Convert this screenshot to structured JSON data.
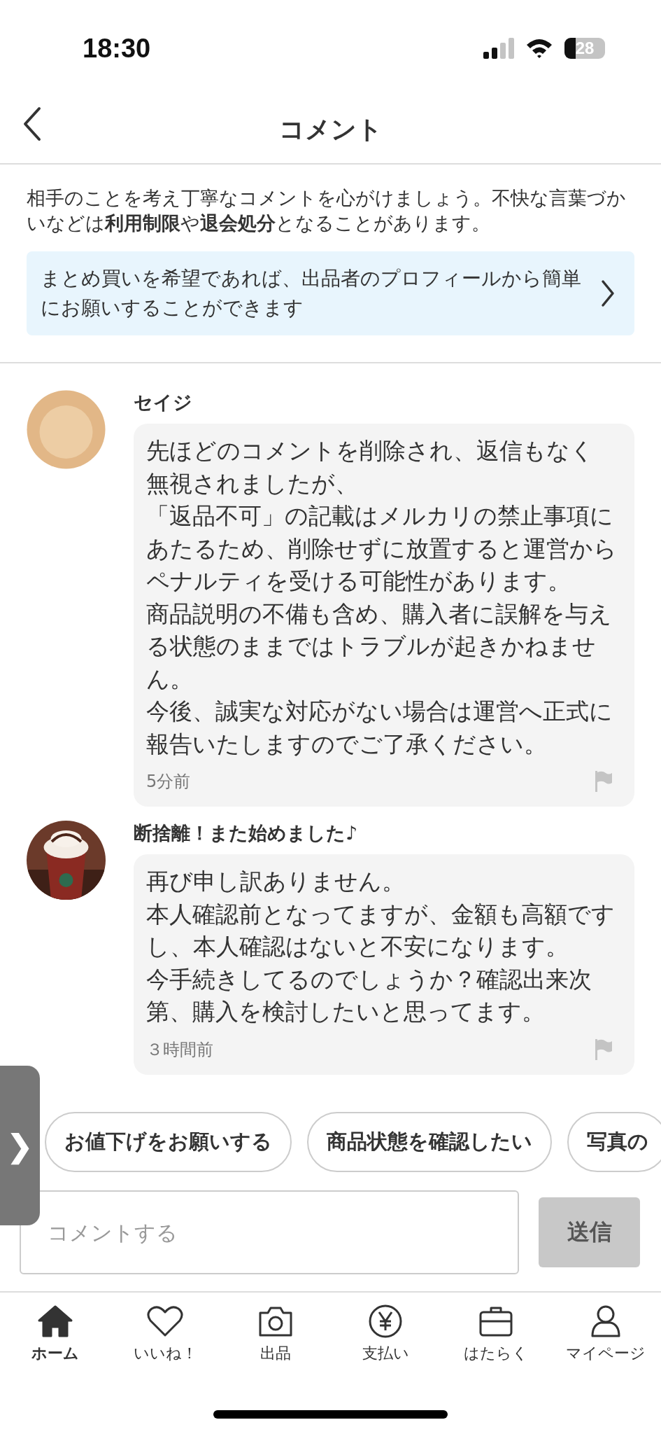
{
  "status_bar": {
    "time": "18:30",
    "battery": "28"
  },
  "header": {
    "title": "コメント"
  },
  "notice": {
    "text": "相手のことを考え丁寧なコメントを心がけましょう。不快な言葉づかいなどは**利用制限**や**退会処分**となることがあります。",
    "banner": "まとめ買いを希望であれば、出品者のプロフィールから簡単にお願いすることができます"
  },
  "comments": [
    {
      "name": "セイジ",
      "avatar": {
        "kind": "illustration"
      },
      "paragraphs": [
        "先ほどのコメントを削除され、返信もなく",
        "無視されましたが、",
        "「返品不可」の記載はメルカリの禁止事項にあたるため、削除せずに放置すると運営からペナルティを受ける可能性があります。",
        "商品説明の不備も含め、購入者に誤解を与える状態のままではトラブルが起きかねません。",
        "今後、誠実な対応がない場合は運営へ正式に報告いたしますのでご了承ください。"
      ],
      "time": "5分前"
    },
    {
      "name": "断捨離！また始めました♪",
      "paragraphs": [
        "再び申し訳ありません。",
        "本人確認前となってますが、金額も高額ですし、本人確認はないと不安になります。",
        "今手続きしてるのでしょうか？確認出来次第、購入を検討したいと思ってます。"
      ],
      "time": "３時間前"
    }
  ],
  "quick_replies": [
    "お値下げをお願いする",
    "商品状態を確認したい",
    "写真の"
  ],
  "composer": {
    "placeholder": "コメントする",
    "send": "送信"
  },
  "side_tab": {
    "glyph": "❯"
  },
  "nav": [
    {
      "label": "ホーム",
      "kind": "home",
      "selected": true
    },
    {
      "label": "いいね！",
      "kind": "heart",
      "selected": false
    },
    {
      "label": "出品",
      "kind": "camera",
      "selected": false
    },
    {
      "label": "支払い",
      "kind": "yen",
      "selected": false
    },
    {
      "label": "はたらく",
      "kind": "bag",
      "selected": false
    },
    {
      "label": "マイページ",
      "kind": "person",
      "selected": false
    }
  ]
}
